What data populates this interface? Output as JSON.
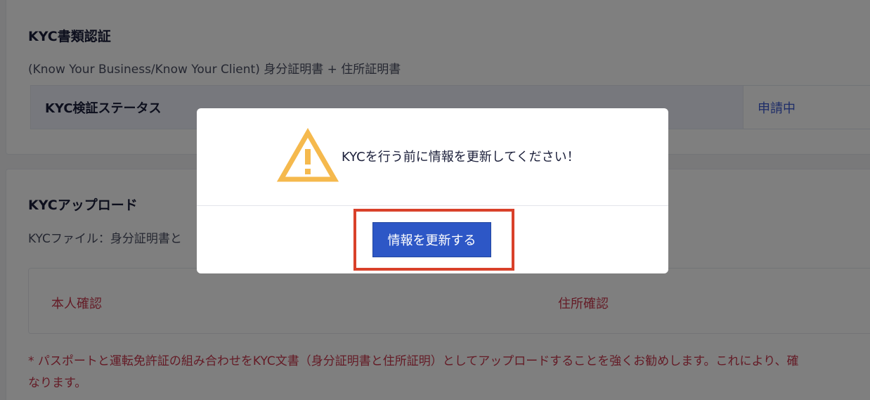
{
  "kyc_docs": {
    "title": "KYC書類認証",
    "description": "(Know Your Business/Know Your Client) 身分証明書 + 住所証明書",
    "status_label": "KYC検証ステータス",
    "status_value": "申請中"
  },
  "kyc_upload": {
    "title": "KYCアップロード",
    "description": "KYCファイル：身分証明書と",
    "identity_label": "本人確認",
    "address_label": "住所確認",
    "note_line1": "* パスポートと運転免許証の組み合わせをKYC文書（身分証明書と住所証明）としてアップロードすることを強くお勧めします。これにより、確",
    "note_line2": "なります。"
  },
  "modal": {
    "icon": "warning-icon",
    "message": "KYCを行う前に情報を更新してください！",
    "button_label": "情報を更新する"
  },
  "colors": {
    "accent": "#2d57c6",
    "warning": "#f5b94d",
    "error_text": "#c9374c",
    "highlight_border": "#d9412a"
  }
}
